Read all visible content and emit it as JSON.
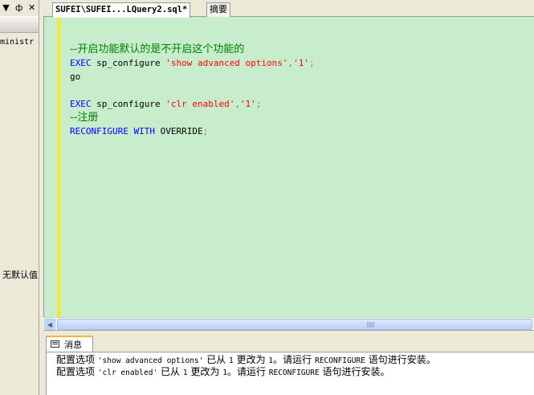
{
  "left_panel": {
    "dropdown_glyph": "▼",
    "pin_glyph": "ф",
    "close_glyph": "✕",
    "tree_text": "ministr",
    "side_text": "无默认值"
  },
  "tabs": [
    {
      "label": "SUFEI\\SUFEI...LQuery2.sql*",
      "active": true
    },
    {
      "label": "摘要",
      "active": false
    }
  ],
  "editor": {
    "lines": [
      {
        "tokens": [
          {
            "t": "--开启功能默认的是不开启这个功能的",
            "c": "cmt"
          }
        ]
      },
      {
        "tokens": [
          {
            "t": "EXEC",
            "c": "kw"
          },
          {
            "t": " sp_configure ",
            "c": "plain"
          },
          {
            "t": "'show advanced options'",
            "c": "str"
          },
          {
            "t": ",",
            "c": "gray"
          },
          {
            "t": "'1'",
            "c": "str"
          },
          {
            "t": ";",
            "c": "gray"
          }
        ]
      },
      {
        "tokens": [
          {
            "t": "go",
            "c": "plain"
          }
        ]
      },
      {
        "tokens": []
      },
      {
        "tokens": [
          {
            "t": "EXEC",
            "c": "kw"
          },
          {
            "t": " sp_configure ",
            "c": "plain"
          },
          {
            "t": "'clr enabled'",
            "c": "str"
          },
          {
            "t": ",",
            "c": "gray"
          },
          {
            "t": "'1'",
            "c": "str"
          },
          {
            "t": ";",
            "c": "gray"
          }
        ]
      },
      {
        "tokens": [
          {
            "t": "--注册",
            "c": "cmt"
          }
        ]
      },
      {
        "tokens": [
          {
            "t": "RECONFIGURE WITH ",
            "c": "kw"
          },
          {
            "t": "OVERRIDE",
            "c": "plain"
          },
          {
            "t": ";",
            "c": "gray"
          }
        ]
      }
    ]
  },
  "scrollbar": {
    "left_arrow": "◀",
    "right_arrow": "▶"
  },
  "results": {
    "tab_label": "消息",
    "messages": [
      [
        {
          "t": "配置选项 ",
          "cn": true
        },
        {
          "t": "'show advanced options'",
          "cn": false
        },
        {
          "t": " 已从 ",
          "cn": true
        },
        {
          "t": "1",
          "cn": false
        },
        {
          "t": " 更改为 ",
          "cn": true
        },
        {
          "t": "1",
          "cn": false
        },
        {
          "t": "。请运行 ",
          "cn": true
        },
        {
          "t": "RECONFIGURE",
          "cn": false
        },
        {
          "t": " 语句进行安装。",
          "cn": true
        }
      ],
      [
        {
          "t": "配置选项 ",
          "cn": true
        },
        {
          "t": "'clr enabled'",
          "cn": false
        },
        {
          "t": " 已从 ",
          "cn": true
        },
        {
          "t": "1",
          "cn": false
        },
        {
          "t": " 更改为 ",
          "cn": true
        },
        {
          "t": "1",
          "cn": false
        },
        {
          "t": "。请运行 ",
          "cn": true
        },
        {
          "t": "RECONFIGURE",
          "cn": false
        },
        {
          "t": " 语句进行安装。",
          "cn": true
        }
      ]
    ]
  },
  "colors": {
    "editor_bg": "#c7edcc",
    "keyword": "#0000ff",
    "string": "#ff0000",
    "comment": "#008000",
    "change_bar": "#ecec46"
  }
}
